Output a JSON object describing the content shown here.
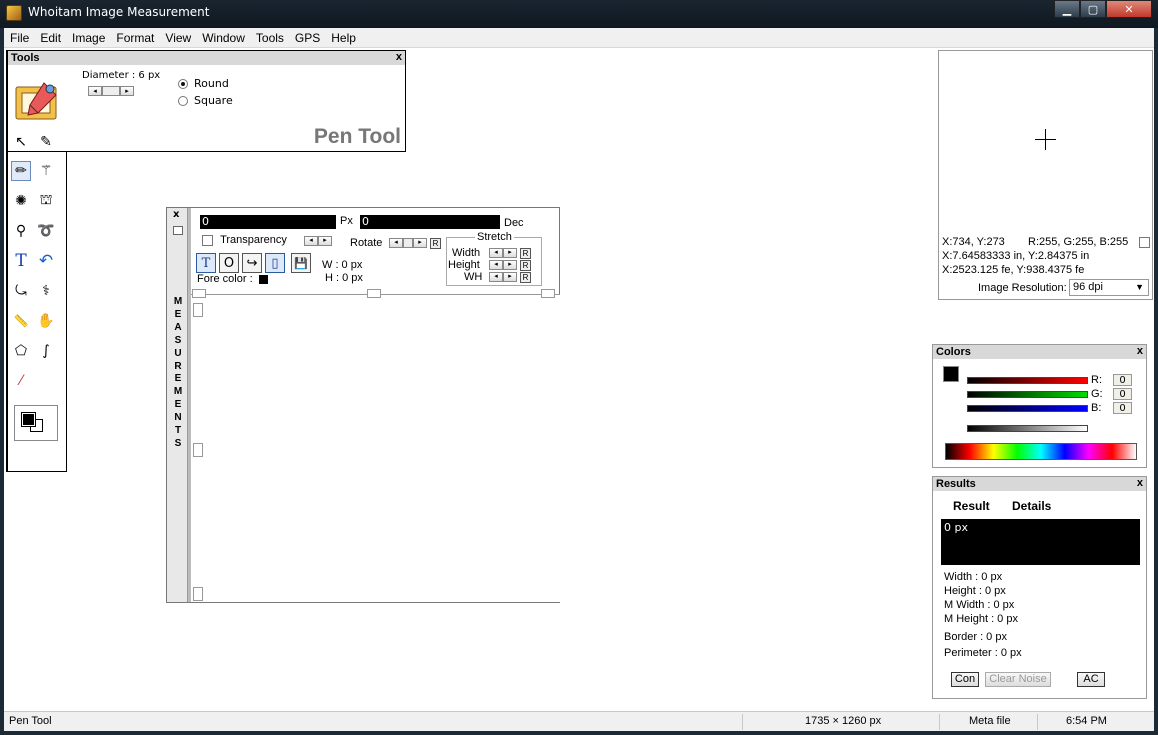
{
  "window": {
    "title": "Whoitam Image Measurement",
    "minimize": "▁",
    "maximize": "▢",
    "close": "✕"
  },
  "menu": [
    "File",
    "Edit",
    "Image",
    "Format",
    "View",
    "Window",
    "Tools",
    "GPS",
    "Help"
  ],
  "tools_panel": {
    "title": "Tools",
    "close": "x",
    "diameter_label": "Diameter : 6 px",
    "shape_options": [
      {
        "label": "Round",
        "selected": true
      },
      {
        "label": "Square",
        "selected": false
      }
    ],
    "active_tool_name": "Pen Tool",
    "tools": [
      {
        "icon": "arrow-icon",
        "glyph": "↖"
      },
      {
        "icon": "eyedropper-icon",
        "glyph": "✎"
      },
      {
        "icon": "pencil-icon",
        "glyph": "✏",
        "selected": true
      },
      {
        "icon": "magic-wand-icon",
        "glyph": "⚚"
      },
      {
        "icon": "spider-web-icon",
        "glyph": "✺"
      },
      {
        "icon": "paint-bucket-icon",
        "glyph": "⛫"
      },
      {
        "icon": "pipette-drop-icon",
        "glyph": "⚲"
      },
      {
        "icon": "lasso-icon",
        "glyph": "➰"
      },
      {
        "icon": "text-icon",
        "glyph": "T"
      },
      {
        "icon": "undo-icon",
        "glyph": "↶"
      },
      {
        "icon": "rotate-crop-icon",
        "glyph": "⤿"
      },
      {
        "icon": "color-picker-icon",
        "glyph": "⚕"
      },
      {
        "icon": "ruler-icon",
        "glyph": "📏"
      },
      {
        "icon": "hand-icon",
        "glyph": "✋"
      },
      {
        "icon": "polygon-lasso-icon",
        "glyph": "⬠"
      },
      {
        "icon": "curve-icon",
        "glyph": "∫"
      },
      {
        "icon": "line-icon",
        "glyph": "⁄"
      }
    ]
  },
  "measurements": {
    "vertical_title": "MEASUREMENTS",
    "close": "x",
    "px_value": "0",
    "px_unit": "Px",
    "dec_value": "0",
    "dec_unit": "Dec",
    "transparency_label": "Transparency",
    "rotate_label": "Rotate",
    "stretch_label": "Stretch",
    "stretch_rows": [
      "Width",
      "Height",
      "WH"
    ],
    "r_button": "R",
    "fore_color_label": "Fore color :",
    "w_label": "W : 0 px",
    "h_label": "H : 0 px",
    "text_buttons": [
      "T",
      "O",
      "↪",
      "▯",
      "💾"
    ]
  },
  "coordinates": {
    "xy": "X:734, Y:273",
    "rgb": "R:255, G:255, B:255",
    "inches": "X:7.64583333 in, Y:2.84375 in",
    "fe": "X:2523.125 fe, Y:938.4375 fe",
    "resolution_label": "Image Resolution:",
    "resolution_value": "96 dpi",
    "dropdown_arrow": "▼"
  },
  "colors_panel": {
    "title": "Colors",
    "close": "x",
    "r_label": "R:",
    "g_label": "G:",
    "b_label": "B:",
    "r_value": "0",
    "g_value": "0",
    "b_value": "0"
  },
  "results_panel": {
    "title": "Results",
    "close": "x",
    "tabs": [
      "Result",
      "Details"
    ],
    "output": "0 px",
    "width": "Width : 0 px",
    "height": "Height : 0 px",
    "m_width": "M Width : 0 px",
    "m_height": "M Height : 0 px",
    "border": "Border : 0 px",
    "perimeter": "Perimeter : 0 px",
    "con_button": "Con",
    "clear_noise_button": "Clear Noise",
    "ac_button": "AC"
  },
  "status": {
    "tool": "Pen Tool",
    "dimensions": "1735 × 1260 px",
    "meta": "Meta file",
    "time": "6:54 PM"
  },
  "colors": {
    "accent_red": "#ff0000",
    "accent_green": "#00dd00",
    "accent_blue": "#0000ff"
  }
}
